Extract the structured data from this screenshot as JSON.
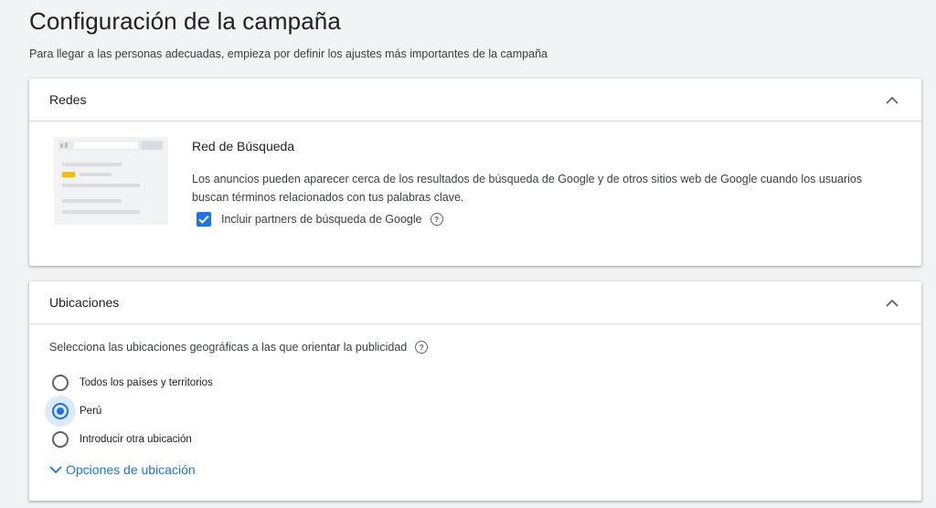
{
  "header": {
    "title": "Configuración de la campaña",
    "subtitle": "Para llegar a las personas adecuadas, empieza por definir los ajustes más importantes de la campaña"
  },
  "redes": {
    "title": "Redes",
    "network_title": "Red de Búsqueda",
    "description": "Los anuncios pueden aparecer cerca de los resultados de búsqueda de Google y de otros sitios web de Google cuando los usuarios buscan términos relacionados con tus palabras clave.",
    "checkbox_label": "Incluir partners de búsqueda de Google",
    "checkbox_checked": true
  },
  "ubicaciones": {
    "title": "Ubicaciones",
    "prompt": "Selecciona las ubicaciones geográficas a las que orientar la publicidad",
    "options": [
      {
        "label": "Todos los países y territorios",
        "selected": false
      },
      {
        "label": "Perú",
        "selected": true
      },
      {
        "label": "Introducir otra ubicación",
        "selected": false
      }
    ],
    "options_link": "Opciones de ubicación"
  },
  "colors": {
    "accent": "#1a73e8",
    "background": "#f1f3f4",
    "card": "#ffffff"
  },
  "icons": [
    "chevron-up-icon",
    "help-icon",
    "checkmark-icon",
    "chevron-down-icon"
  ]
}
